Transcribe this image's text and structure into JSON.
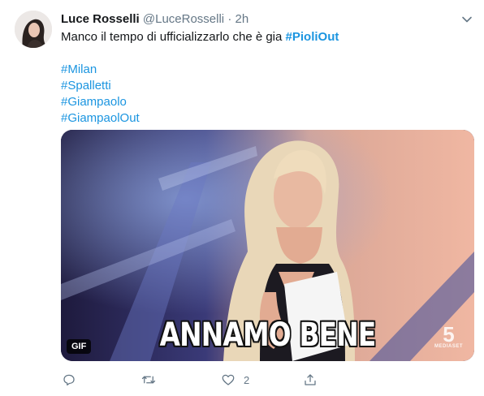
{
  "tweet": {
    "author": "Luce Rosselli",
    "handle": "@LuceRosselli",
    "separator": "·",
    "time": "2h",
    "text_main": "Manco il tempo di ufficializzarlo che è gia ",
    "text_hashtag": "#PioliOut",
    "hashtags": [
      "#Milan",
      "#Spalletti",
      "#Giampaolo",
      "#GiampaolOut"
    ],
    "media": {
      "caption": "ANNAMO BENE",
      "badge": "GIF",
      "watermark_number": "5",
      "watermark_text": "MEDIASET"
    },
    "actions": {
      "reply_icon": "reply-icon",
      "retweet_icon": "retweet-icon",
      "like_icon": "heart-icon",
      "like_count": "2",
      "share_icon": "share-icon"
    },
    "colors": {
      "link": "#1b95e0",
      "muted": "#657786"
    }
  }
}
